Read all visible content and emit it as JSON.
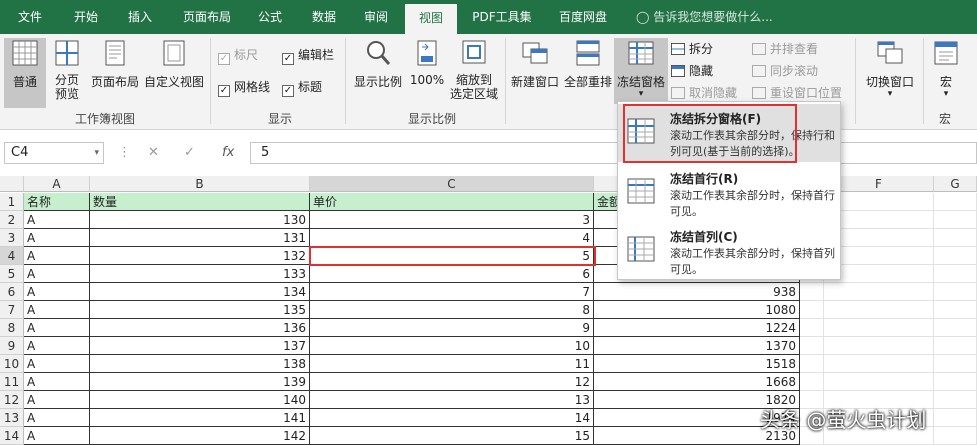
{
  "tabs": [
    "文件",
    "开始",
    "插入",
    "页面布局",
    "公式",
    "数据",
    "审阅",
    "视图",
    "PDF工具集",
    "百度网盘"
  ],
  "tell_me": "告诉我您想要做什么...",
  "ribbon": {
    "workbook_views": {
      "label": "工作簿视图",
      "normal": "普通",
      "page_break": "分页\n预览",
      "page_layout": "页面布局",
      "custom": "自定义视图"
    },
    "show": {
      "label": "显示",
      "ruler": "标尺",
      "gridlines": "网格线",
      "formula_bar": "编辑栏",
      "headings": "标题"
    },
    "zoom": {
      "label": "显示比例",
      "zoom": "显示比例",
      "zoom100": "100%",
      "zoom_sel": "缩放到\n选定区域"
    },
    "window": {
      "new_window": "新建窗口",
      "arrange_all": "全部重排",
      "freeze": "冻结窗格",
      "split": "拆分",
      "hide": "隐藏",
      "unhide": "取消隐藏",
      "side_by_side": "并排查看",
      "sync_scroll": "同步滚动",
      "reset_pos": "重设窗口位置",
      "switch": "切换窗口"
    },
    "macro": {
      "label": "宏",
      "macro": "宏"
    }
  },
  "formula_bar": {
    "name_box": "C4",
    "value": "5",
    "fx": "fx"
  },
  "columns": [
    "A",
    "B",
    "C",
    "",
    "F",
    "G"
  ],
  "header_row": [
    "名称",
    "数量",
    "单价",
    "金额"
  ],
  "rows": [
    {
      "n": "2",
      "a": "A",
      "b": "130",
      "c": "3",
      "d": ""
    },
    {
      "n": "3",
      "a": "A",
      "b": "131",
      "c": "4",
      "d": ""
    },
    {
      "n": "4",
      "a": "A",
      "b": "132",
      "c": "5",
      "d": ""
    },
    {
      "n": "5",
      "a": "A",
      "b": "133",
      "c": "6",
      "d": ""
    },
    {
      "n": "6",
      "a": "A",
      "b": "134",
      "c": "7",
      "d": "938"
    },
    {
      "n": "7",
      "a": "A",
      "b": "135",
      "c": "8",
      "d": "1080"
    },
    {
      "n": "8",
      "a": "A",
      "b": "136",
      "c": "9",
      "d": "1224"
    },
    {
      "n": "9",
      "a": "A",
      "b": "137",
      "c": "10",
      "d": "1370"
    },
    {
      "n": "10",
      "a": "A",
      "b": "138",
      "c": "11",
      "d": "1518"
    },
    {
      "n": "11",
      "a": "A",
      "b": "139",
      "c": "12",
      "d": "1668"
    },
    {
      "n": "12",
      "a": "A",
      "b": "140",
      "c": "13",
      "d": "1820"
    },
    {
      "n": "13",
      "a": "A",
      "b": "141",
      "c": "14",
      "d": "1974"
    },
    {
      "n": "14",
      "a": "A",
      "b": "142",
      "c": "15",
      "d": "2130"
    }
  ],
  "freeze_menu": [
    {
      "title": "冻结拆分窗格(F)",
      "desc": "滚动工作表其余部分时，保持行和列可见(基于当前的选择)。"
    },
    {
      "title": "冻结首行(R)",
      "desc": "滚动工作表其余部分时，保持首行可见。"
    },
    {
      "title": "冻结首列(C)",
      "desc": "滚动工作表其余部分时，保持首列可见。"
    }
  ],
  "watermark": "头条 @萤火虫计划",
  "colors": {
    "excel_green": "#217346",
    "header_fill": "#c6efce",
    "highlight_red": "#e03030"
  }
}
